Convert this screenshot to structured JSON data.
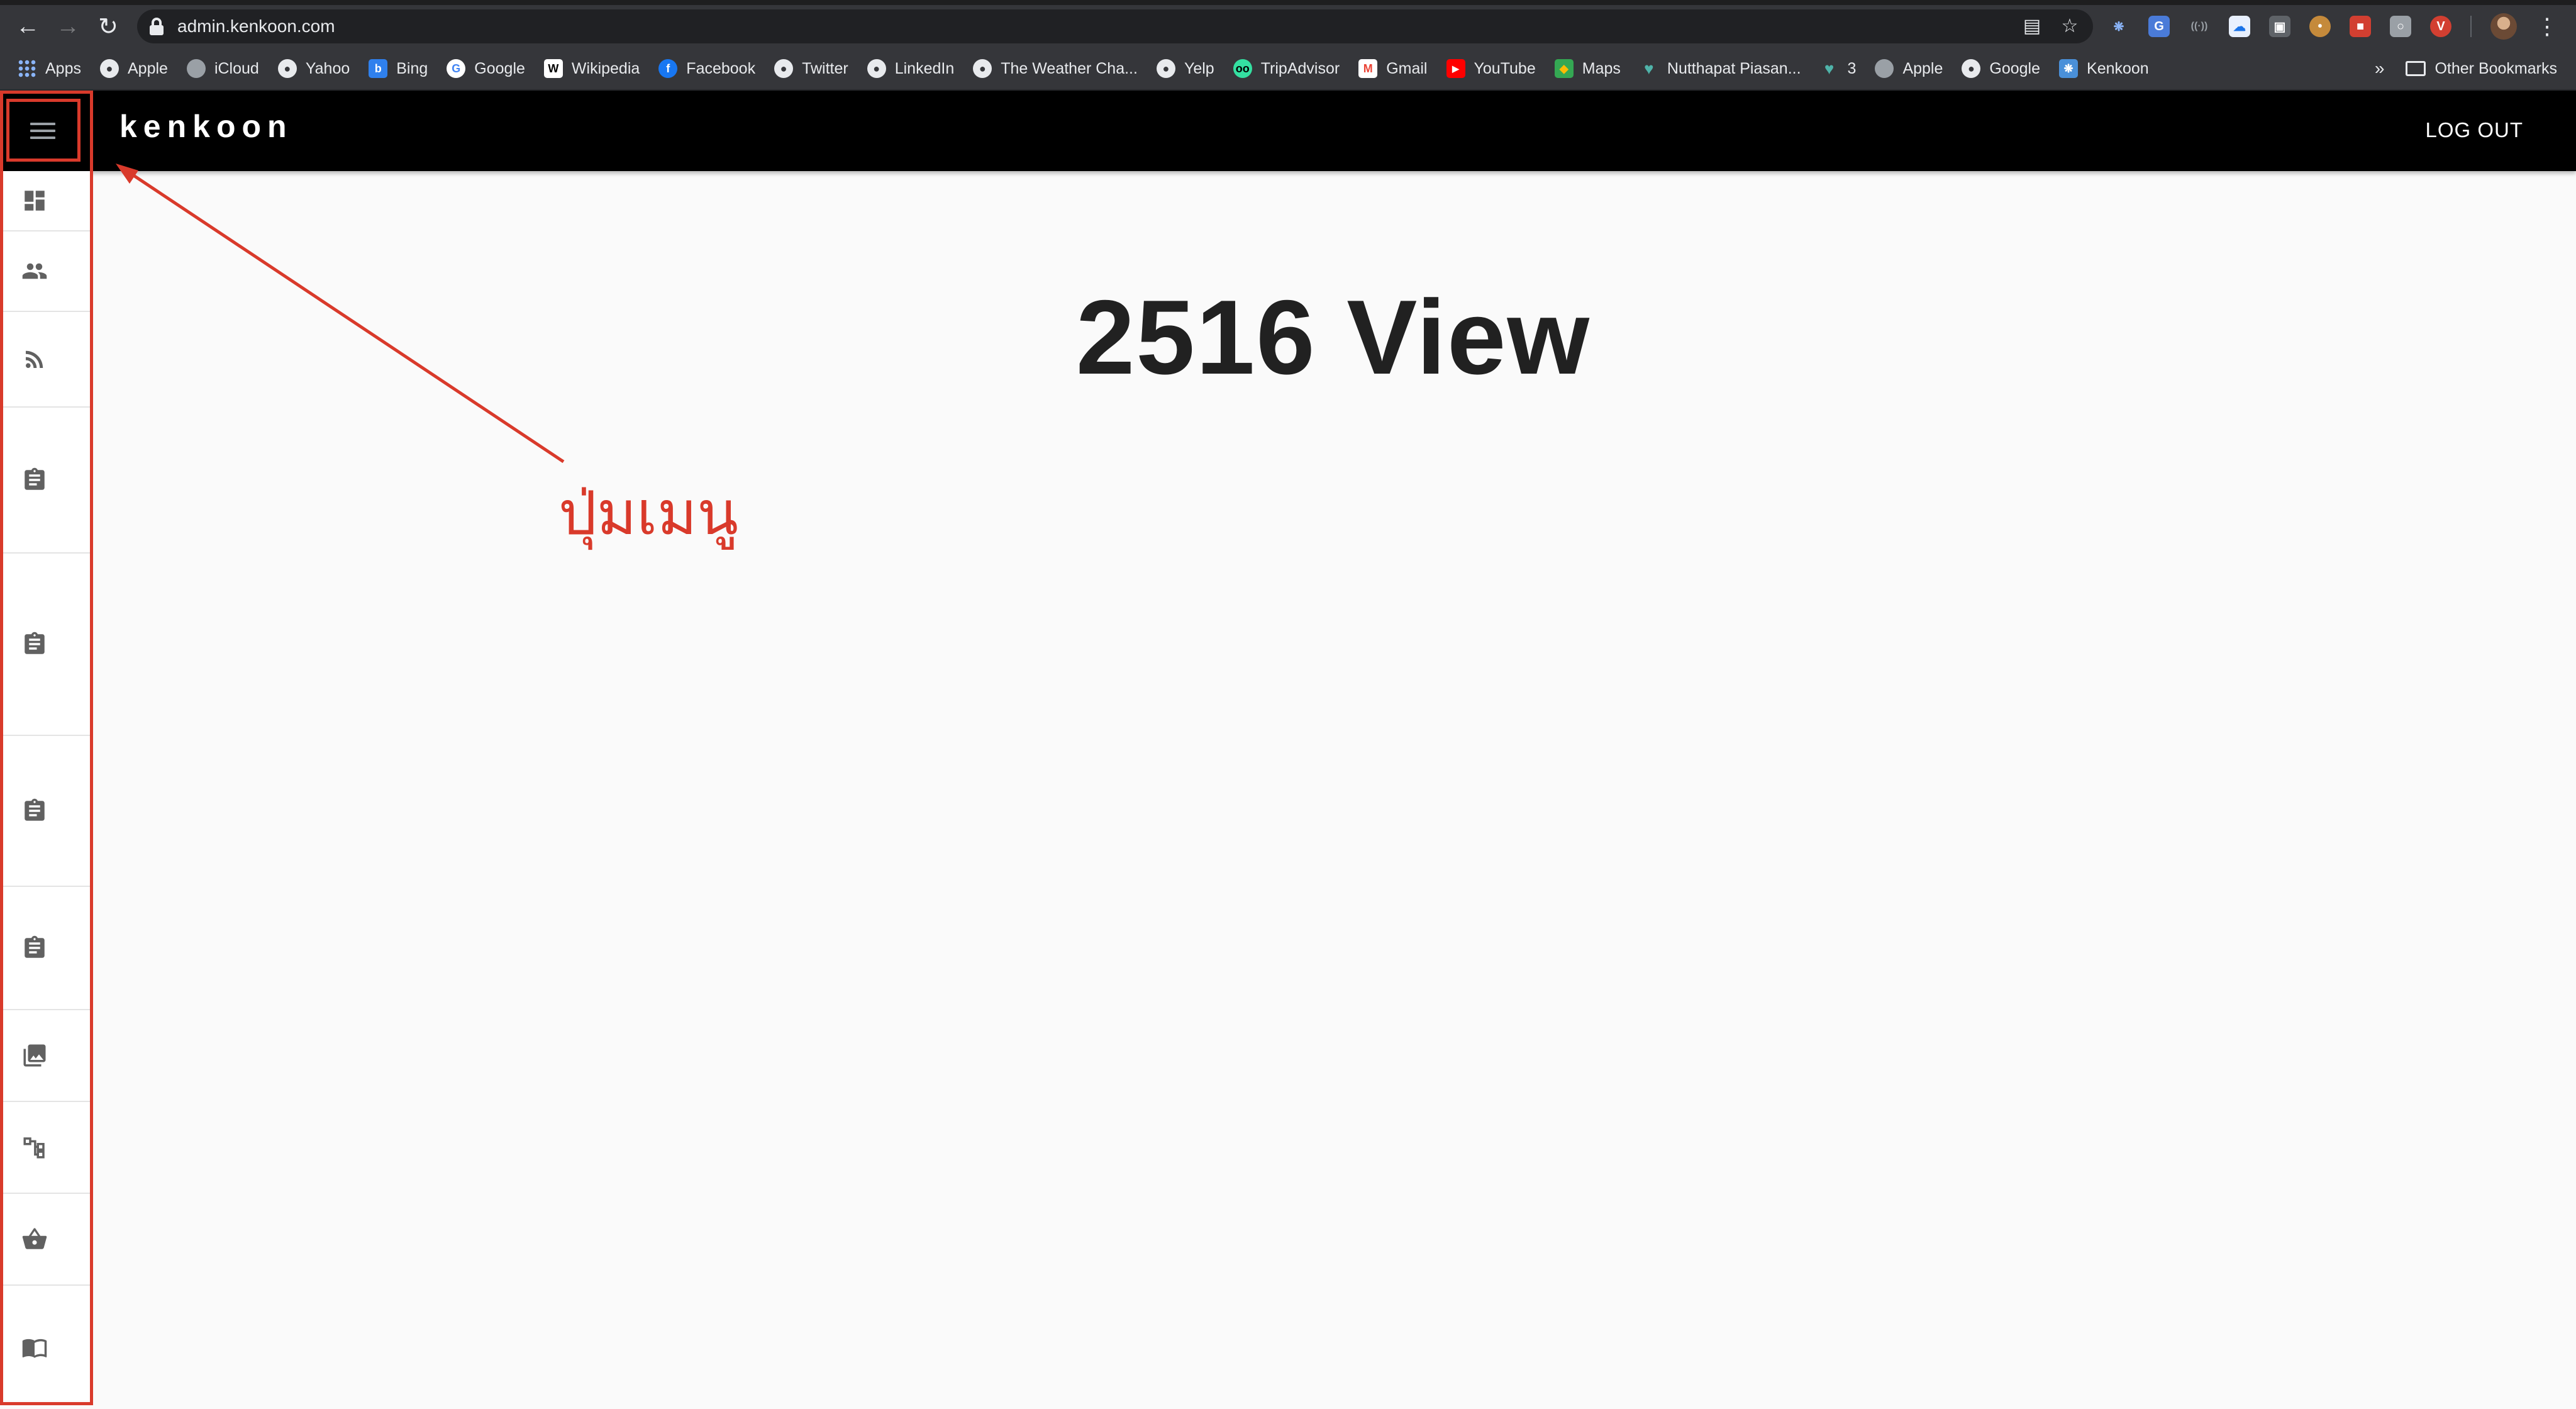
{
  "browser": {
    "url": "admin.kenkoon.com",
    "bookmarks": [
      {
        "label": "Apps",
        "icon": "apps-grid-icon"
      },
      {
        "label": "Apple",
        "icon": "apple-icon"
      },
      {
        "label": "iCloud",
        "icon": "apple-icon"
      },
      {
        "label": "Yahoo",
        "icon": "globe-icon"
      },
      {
        "label": "Bing",
        "icon": "bing-icon"
      },
      {
        "label": "Google",
        "icon": "google-icon"
      },
      {
        "label": "Wikipedia",
        "icon": "wikipedia-icon"
      },
      {
        "label": "Facebook",
        "icon": "facebook-icon"
      },
      {
        "label": "Twitter",
        "icon": "globe-icon"
      },
      {
        "label": "LinkedIn",
        "icon": "globe-icon"
      },
      {
        "label": "The Weather Cha...",
        "icon": "globe-icon"
      },
      {
        "label": "Yelp",
        "icon": "globe-icon"
      },
      {
        "label": "TripAdvisor",
        "icon": "tripadvisor-icon"
      },
      {
        "label": "Gmail",
        "icon": "gmail-icon"
      },
      {
        "label": "YouTube",
        "icon": "youtube-icon"
      },
      {
        "label": "Maps",
        "icon": "maps-icon"
      },
      {
        "label": "Nutthapat Piasan...",
        "icon": "heart-icon"
      },
      {
        "label": "3",
        "icon": "heart-icon"
      },
      {
        "label": "Apple",
        "icon": "apple-icon"
      },
      {
        "label": "Google",
        "icon": "globe-icon"
      },
      {
        "label": "Kenkoon",
        "icon": "kenkoon-icon"
      }
    ],
    "bookmarks_overflow": "»",
    "other_bookmarks": "Other Bookmarks"
  },
  "header": {
    "brand": "kenkoon",
    "logout_label": "LOG OUT"
  },
  "sidebar": {
    "items": [
      {
        "icon": "dashboard-icon"
      },
      {
        "icon": "people-icon"
      },
      {
        "icon": "rss-feed-icon"
      },
      {
        "icon": "clipboard-icon"
      },
      {
        "icon": "clipboard-icon"
      },
      {
        "icon": "clipboard-icon"
      },
      {
        "icon": "clipboard-icon"
      },
      {
        "icon": "photo-library-icon"
      },
      {
        "icon": "sitemap-icon"
      },
      {
        "icon": "shopping-basket-icon"
      },
      {
        "icon": "book-icon"
      }
    ]
  },
  "main": {
    "title": "2516 View"
  },
  "annotation": {
    "label": "ปุ่มเมนู",
    "color": "#d93a2b"
  },
  "colors": {
    "header_bg": "#000000",
    "page_bg": "#fafafa",
    "annotation": "#d93a2b"
  }
}
